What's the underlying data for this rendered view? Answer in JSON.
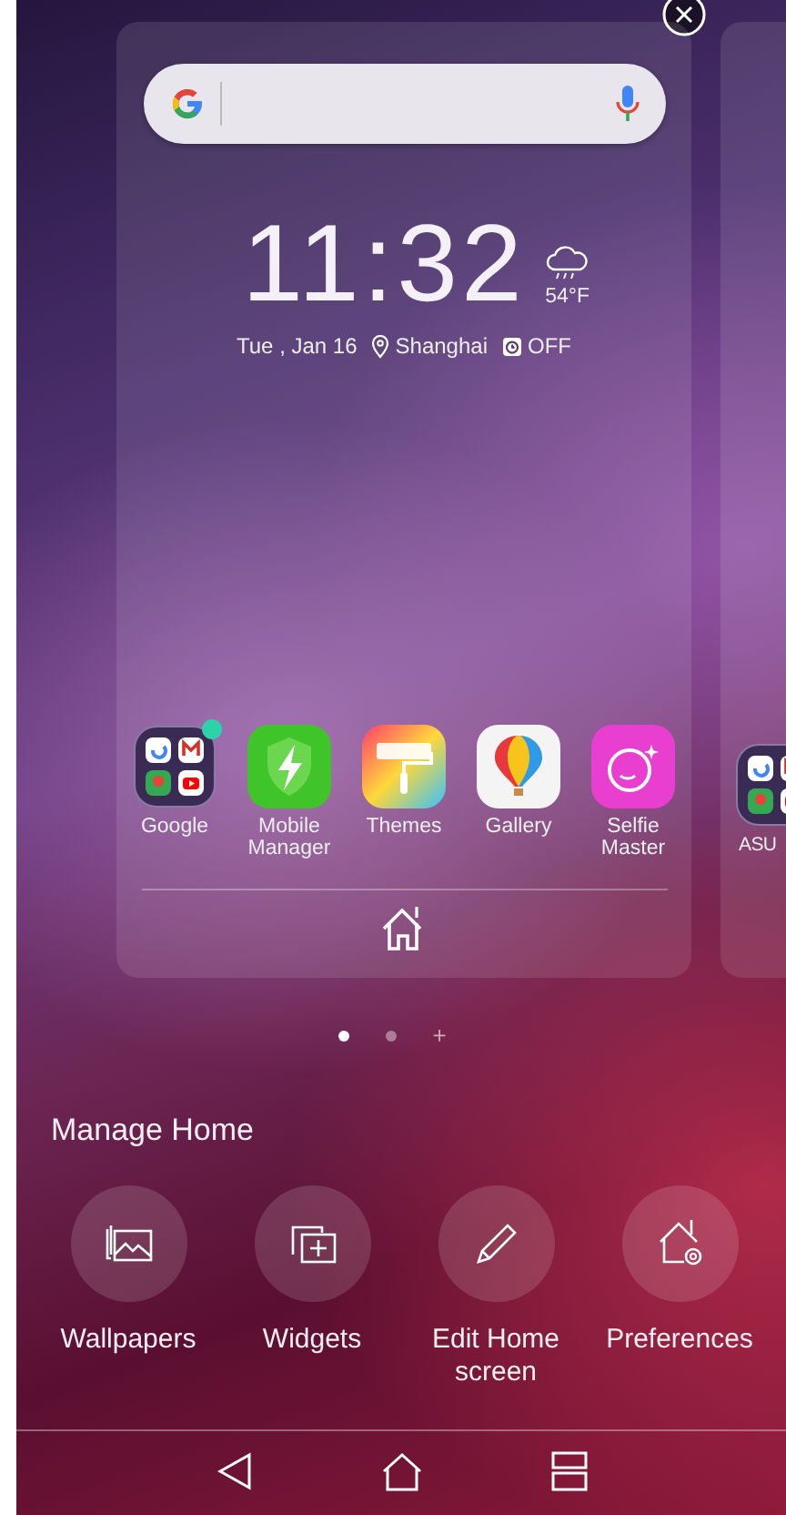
{
  "clock": {
    "time": "11:32",
    "temperature": "54°F",
    "date": "Tue , Jan 16",
    "location": "Shanghai",
    "alarm": "OFF"
  },
  "apps": [
    {
      "label": "Google",
      "kind": "folder",
      "badge": true
    },
    {
      "label": "Mobile Manager",
      "kind": "shield",
      "badge": false
    },
    {
      "label": "Themes",
      "kind": "roller",
      "badge": false
    },
    {
      "label": "Gallery",
      "kind": "balloon",
      "badge": false
    },
    {
      "label": "Selfie Master",
      "kind": "selfie",
      "badge": false
    }
  ],
  "next_page_app": {
    "label": "ASU",
    "kind": "folder"
  },
  "page_indicator": [
    {
      "kind": "dot",
      "selected": true
    },
    {
      "kind": "dot",
      "selected": false
    },
    {
      "kind": "add",
      "label": "+"
    }
  ],
  "manage_home": {
    "title": "Manage Home",
    "actions": [
      {
        "label": "Wallpapers",
        "kind": "wallpapers"
      },
      {
        "label": "Widgets",
        "kind": "widgets"
      },
      {
        "label": "Edit Home screen",
        "kind": "edit"
      },
      {
        "label": "Preferences",
        "kind": "preferences"
      }
    ]
  }
}
